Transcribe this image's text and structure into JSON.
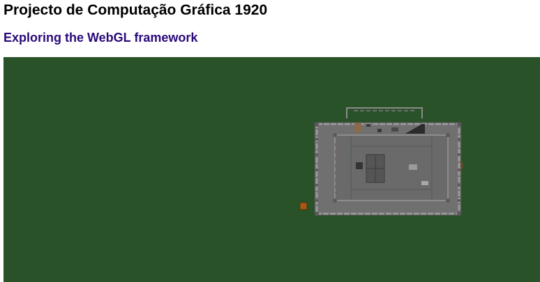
{
  "page": {
    "title": "Projecto de Computação Gráfica 1920",
    "subtitle": "Exploring the WebGL framework"
  },
  "colors": {
    "subtitle": "#2a0a7a",
    "canvas_background": "#295229",
    "building_floor": "#707070",
    "wall": "#8a8a8a",
    "dark_detail": "#2b2b2b",
    "crate": "#a35a14"
  },
  "scene": {
    "objects": [
      "ground-plane",
      "building",
      "walls",
      "pillars",
      "staircase",
      "doors",
      "crate"
    ]
  }
}
